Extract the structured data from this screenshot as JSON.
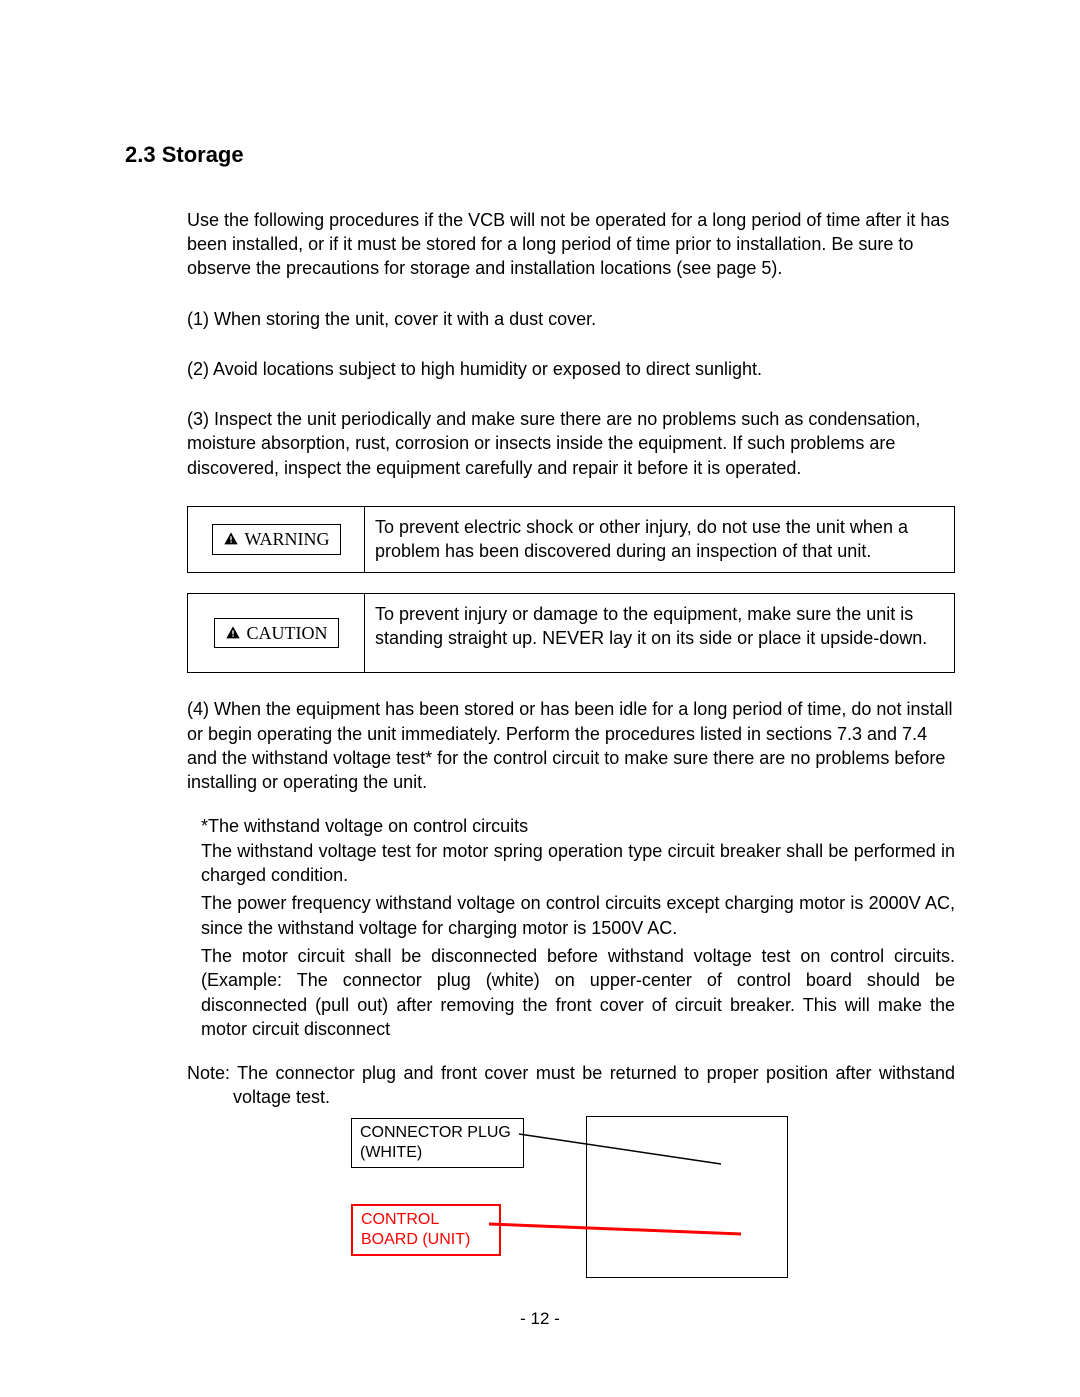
{
  "section": {
    "heading": "2.3 Storage"
  },
  "paragraphs": {
    "intro": "Use the following procedures if the VCB will not be operated for a long period of time after it has been installed, or if it must be stored for a long period of time prior to installation. Be sure to observe the precautions for storage and installation locations (see page 5).",
    "p1": "(1) When storing the unit, cover it with a dust cover.",
    "p2": "(2) Avoid locations subject to high humidity or exposed to direct sunlight.",
    "p3": "(3) Inspect the unit periodically and make sure there are no problems such as condensation, moisture absorption, rust, corrosion or insects inside the equipment. If such problems are discovered, inspect the equipment carefully and repair it before it is operated.",
    "p4": "(4) When the equipment has been stored or has been idle for a long period of time, do not install or begin operating the unit immediately. Perform the procedures listed in sections 7.3 and 7.4 and the withstand voltage test* for the control circuit to make sure there are no problems before installing or operating the unit."
  },
  "callouts": {
    "warning_label": "WARNING",
    "warning_text": "To prevent electric shock or other injury, do not use the unit when a problem has been discovered during an inspection of that unit.",
    "caution_label": "CAUTION",
    "caution_text": "To prevent injury or damage to the equipment, make sure the unit is standing straight up. NEVER lay it on its side or place it upside-down."
  },
  "notes": {
    "n_title": "*The withstand voltage on control circuits",
    "n_body1": "The withstand voltage test for motor spring operation type circuit breaker shall be performed in charged condition.",
    "n_body2": "The power frequency withstand voltage on control circuits except charging motor is 2000V AC, since the withstand voltage for charging motor is 1500V AC.",
    "n_body3": "The motor circuit shall be disconnected before withstand voltage test on control circuits. (Example: The connector plug (white) on upper-center of control board should be disconnected (pull out) after removing the front cover of circuit breaker. This will make the motor circuit disconnect",
    "n_final": "Note: The connector plug and front cover must be returned to proper position after withstand voltage test."
  },
  "diagram": {
    "connector_plug_label": "CONNECTOR PLUG (WHITE)",
    "control_board_label": "CONTROL BOARD (UNIT)"
  },
  "page_number": "- 12 -"
}
